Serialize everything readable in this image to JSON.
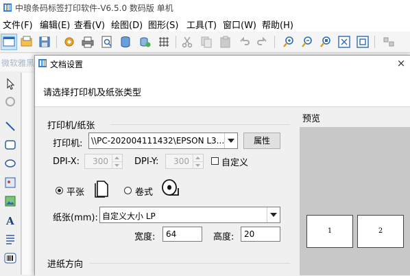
{
  "window": {
    "title": "中琅条码标签打印软件-V6.5.0 数码版 单机"
  },
  "menu": {
    "items": [
      "文件(F)",
      "编辑(E)",
      "查看(V)",
      "绘图(D)",
      "图形(S)",
      "工具(T)",
      "窗口(W)",
      "帮助(H)"
    ]
  },
  "toolbar": {
    "icons": [
      "new-icon",
      "open-icon",
      "save-icon",
      "settings-icon",
      "print-icon",
      "print-preview-icon",
      "database-icon",
      "data-import-icon",
      "grid-icon",
      "cut-icon",
      "copy-icon",
      "paste-icon",
      "undo-icon",
      "redo-icon",
      "zoom-in-icon",
      "zoom-out-icon",
      "zoom-fit-icon",
      "zoom-all-icon",
      "zoom-page-icon",
      "align-icon"
    ]
  },
  "background": {
    "font_strip": "微软雅黑"
  },
  "dialog": {
    "title": "文档设置",
    "close": "×",
    "header_text": "请选择打印机及纸张类型",
    "printer_group": {
      "title": "打印机/纸张",
      "printer_label": "打印机:",
      "printer_value": "\\\\PC-202004111432\\EPSON L3...",
      "properties_button": "属性",
      "dpi_x_label": "DPI-X:",
      "dpi_x_value": "300",
      "dpi_y_label": "DPI-Y:",
      "dpi_y_value": "300",
      "custom_label": "自定义",
      "custom_checked": false,
      "paper_type_sheet": "平张",
      "paper_type_roll": "卷式",
      "paper_type_selected": "平张",
      "paper_label": "纸张(mm):",
      "paper_value": "自定义大小 LP",
      "width_label": "宽度:",
      "width_value": "64",
      "height_label": "高度:",
      "height_value": "20"
    },
    "feed_group": {
      "title": "进纸方向"
    },
    "preview": {
      "title": "预览",
      "pages": [
        "1",
        "2"
      ]
    }
  }
}
